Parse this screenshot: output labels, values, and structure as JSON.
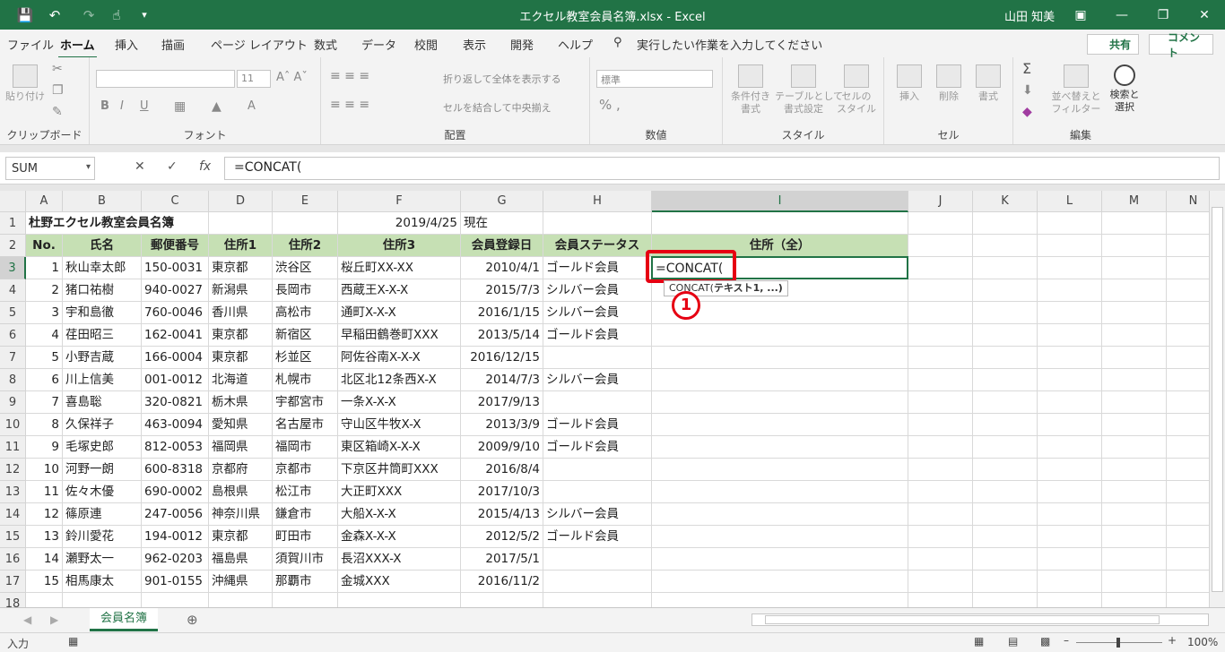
{
  "title": {
    "file": "エクセル教室会員名簿.xlsx  -  Excel",
    "user": "山田 知美",
    "share": "共有",
    "comment": "コメント"
  },
  "menu": {
    "tabs": [
      "ファイル",
      "ホーム",
      "挿入",
      "描画",
      "ページ レイアウト",
      "数式",
      "データ",
      "校閲",
      "表示",
      "開発",
      "ヘルプ"
    ],
    "tell_me": "実行したい作業を入力してください"
  },
  "ribbon": {
    "clipboard": {
      "label": "クリップボード",
      "paste": "貼り付け"
    },
    "font": {
      "label": "フォント",
      "size": "11"
    },
    "align": {
      "label": "配置",
      "wrap": "折り返して全体を表示する",
      "merge": "セルを結合して中央揃え"
    },
    "number": {
      "label": "数値",
      "format": "標準"
    },
    "style": {
      "label": "スタイル",
      "cond": "条件付き\n書式",
      "table": "テーブルとして\n書式設定",
      "cellstyle": "セルの\nスタイル"
    },
    "cells": {
      "label": "セル",
      "insert": "挿入",
      "delete": "削除",
      "format": "書式"
    },
    "edit": {
      "label": "編集",
      "sort": "並べ替えと\nフィルター",
      "find": "検索と\n選択"
    }
  },
  "formula_bar": {
    "name_box": "SUM",
    "formula": "=CONCAT("
  },
  "columns": [
    "A",
    "B",
    "C",
    "D",
    "E",
    "F",
    "G",
    "H",
    "I",
    "J",
    "K",
    "L",
    "M",
    "N"
  ],
  "rows": [
    "1",
    "2",
    "3",
    "4",
    "5",
    "6",
    "7",
    "8",
    "9",
    "10",
    "11",
    "12",
    "13",
    "14",
    "15",
    "16",
    "17",
    "18"
  ],
  "sheet": {
    "title": "杜野エクセル教室会員名簿",
    "date": "2019/4/25",
    "date_suffix": "現在",
    "headers": [
      "No.",
      "氏名",
      "郵便番号",
      "住所1",
      "住所2",
      "住所3",
      "会員登録日",
      "会員ステータス",
      "住所（全）"
    ],
    "data": [
      [
        "1",
        "秋山幸太郎",
        "150-0031",
        "東京都",
        "渋谷区",
        "桜丘町XX-XX",
        "2010/4/1",
        "ゴールド会員"
      ],
      [
        "2",
        "猪口祐樹",
        "940-0027",
        "新潟県",
        "長岡市",
        "西蔵王X-X-X",
        "2015/7/3",
        "シルバー会員"
      ],
      [
        "3",
        "宇和島徹",
        "760-0046",
        "香川県",
        "高松市",
        "通町X-X-X",
        "2016/1/15",
        "シルバー会員"
      ],
      [
        "4",
        "荏田昭三",
        "162-0041",
        "東京都",
        "新宿区",
        "早稲田鶴巻町XXX",
        "2013/5/14",
        "ゴールド会員"
      ],
      [
        "5",
        "小野吉蔵",
        "166-0004",
        "東京都",
        "杉並区",
        "阿佐谷南X-X-X",
        "2016/12/15",
        ""
      ],
      [
        "6",
        "川上信美",
        "001-0012",
        "北海道",
        "札幌市",
        "北区北12条西X-X",
        "2014/7/3",
        "シルバー会員"
      ],
      [
        "7",
        "喜島聡",
        "320-0821",
        "栃木県",
        "宇都宮市",
        "一条X-X-X",
        "2017/9/13",
        ""
      ],
      [
        "8",
        "久保祥子",
        "463-0094",
        "愛知県",
        "名古屋市",
        "守山区牛牧X-X",
        "2013/3/9",
        "ゴールド会員"
      ],
      [
        "9",
        "毛塚史郎",
        "812-0053",
        "福岡県",
        "福岡市",
        "東区箱崎X-X-X",
        "2009/9/10",
        "ゴールド会員"
      ],
      [
        "10",
        "河野一朗",
        "600-8318",
        "京都府",
        "京都市",
        "下京区井筒町XXX",
        "2016/8/4",
        ""
      ],
      [
        "11",
        "佐々木優",
        "690-0002",
        "島根県",
        "松江市",
        "大正町XXX",
        "2017/10/3",
        ""
      ],
      [
        "12",
        "篠原連",
        "247-0056",
        "神奈川県",
        "鎌倉市",
        "大船X-X-X",
        "2015/4/13",
        "シルバー会員"
      ],
      [
        "13",
        "鈴川愛花",
        "194-0012",
        "東京都",
        "町田市",
        "金森X-X-X",
        "2012/5/2",
        "ゴールド会員"
      ],
      [
        "14",
        "瀬野太一",
        "962-0203",
        "福島県",
        "須賀川市",
        "長沼XXX-X",
        "2017/5/1",
        ""
      ],
      [
        "15",
        "相馬康太",
        "901-0155",
        "沖縄県",
        "那覇市",
        "金城XXX",
        "2016/11/2",
        ""
      ]
    ],
    "edit_cell": "=CONCAT(",
    "tooltip_fn": "CONCAT(",
    "tooltip_args": "テキスト1, ...)",
    "marker": "1"
  },
  "sheet_tab": "会員名簿",
  "status": {
    "mode": "入力",
    "zoom": "100%"
  },
  "accent": "#217346",
  "header_fill": "#c6e0b4",
  "highlight": "#e60012"
}
